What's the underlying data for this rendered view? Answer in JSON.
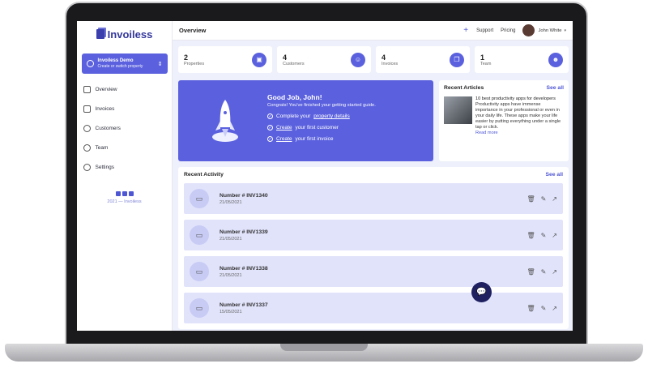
{
  "brand": {
    "name": "Invoiless"
  },
  "switcher": {
    "title": "Invoiless Demo",
    "subtitle": "Create or switch property"
  },
  "sidebar": {
    "items": [
      {
        "label": "Overview",
        "icon": "home-icon"
      },
      {
        "label": "Invoices",
        "icon": "copy-icon"
      },
      {
        "label": "Customers",
        "icon": "users-icon"
      },
      {
        "label": "Team",
        "icon": "team-icon"
      },
      {
        "label": "Settings",
        "icon": "gear-icon"
      }
    ],
    "copyright": "2021 — Invoiless"
  },
  "topbar": {
    "title": "Overview",
    "support": "Support",
    "pricing": "Pricing",
    "user": "John White"
  },
  "stats": [
    {
      "value": "2",
      "label": "Properties",
      "icon": "box-icon"
    },
    {
      "value": "4",
      "label": "Customers",
      "icon": "users-icon"
    },
    {
      "value": "4",
      "label": "Invoices",
      "icon": "copy-icon"
    },
    {
      "value": "1",
      "label": "Team",
      "icon": "user-icon"
    }
  ],
  "hero": {
    "heading": "Good Job, John!",
    "subtext": "Congrats! You've finished your getting started guide.",
    "todos": [
      {
        "prefix": "Complete your ",
        "link": "property details",
        "suffix": ""
      },
      {
        "prefix": "",
        "link": "Create",
        "suffix": " your first customer"
      },
      {
        "prefix": "",
        "link": "Create",
        "suffix": " your first invoice"
      }
    ]
  },
  "articles": {
    "title": "Recent Articles",
    "see_all": "See all",
    "item_title": "10 best productivity apps for developers",
    "item_body": "Productivity apps have immense importance in your professional or even in your daily life. These apps make your life easier by putting everything under a single tap or click.",
    "read_more": "Read more"
  },
  "activity": {
    "title": "Recent Activity",
    "see_all": "See all",
    "rows": [
      {
        "number": "Number # INV1340",
        "date": "21/05/2021"
      },
      {
        "number": "Number # INV1339",
        "date": "21/05/2021"
      },
      {
        "number": "Number # INV1338",
        "date": "21/05/2021"
      },
      {
        "number": "Number # INV1337",
        "date": "15/05/2021"
      }
    ]
  },
  "colors": {
    "accent": "#5b61de",
    "brand": "#33379b",
    "row_bg": "#e1e3fb"
  }
}
